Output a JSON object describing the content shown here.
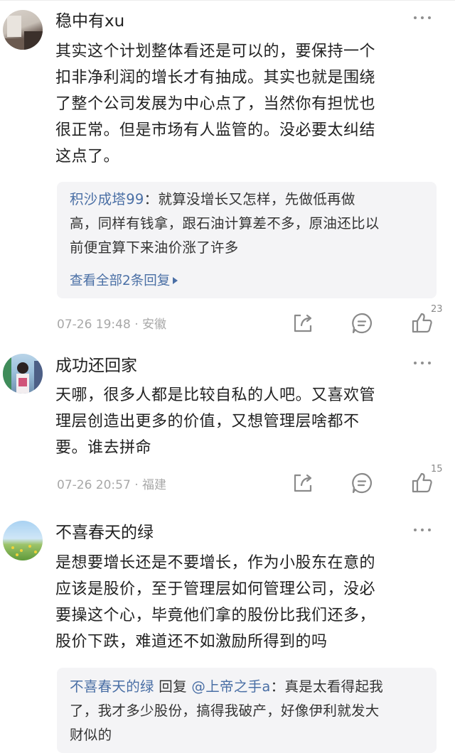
{
  "comments": [
    {
      "username": "稳中有xu",
      "lines": [
        "其实这个计划整体看还是可以的，要保持一个",
        "扣非净利润的增长才有抽成。其实也就是围绕",
        "了整个公司发展为中心点了，当然你有担忧也",
        "很正常。但是市场有人监管的。没必要太纠结",
        "这点了。"
      ],
      "reply": {
        "author": "积沙成塔99",
        "sep": "：",
        "first_line": "就算没增长又怎样，先做低再做",
        "lines": [
          "高，同样有钱拿，跟石油计算差不多，原油还比以",
          "前便宜算下来油价涨了许多"
        ]
      },
      "see_all": "查看全部2条回复",
      "time": "07-26 19:48",
      "dot": "·",
      "location": "安徽",
      "likes": "23",
      "avatar_icon": "user-avatar-portrait"
    },
    {
      "username": "成功还回家",
      "lines": [
        "天哪，很多人都是比较自私的人吧。又喜欢管",
        "理层创造出更多的价值，又想管理层啥都不",
        "要。谁去拼命"
      ],
      "time": "07-26 20:57",
      "dot": "·",
      "location": "福建",
      "likes": "15",
      "avatar_icon": "user-avatar-person"
    },
    {
      "username": "不喜春天的绿",
      "lines": [
        "是想要增长还是不要增长，作为小股东在意的",
        "应该是股价，至于管理层如何管理公司，没必",
        "要操这个心，毕竟他们拿的股份比我们还多，",
        "股价下跌，难道还不如激励所得到的吗"
      ],
      "reply": {
        "author": "不喜春天的绿",
        "mid": " 回复 ",
        "target": "@上帝之手a",
        "sep": "：",
        "first_line": "真是太看得起我",
        "lines": [
          "了，我才多少股份，搞得我破产，好像伊利就发大",
          "财似的"
        ]
      },
      "avatar_icon": "user-avatar-meadow"
    }
  ],
  "icons": {
    "share": "share-icon",
    "comment": "comment-icon",
    "like": "thumbs-up-icon",
    "more": "more-icon"
  },
  "colors": {
    "link": "#4a6fa5",
    "meta": "#a8a8a8",
    "reply_bg": "#f4f4f6"
  }
}
